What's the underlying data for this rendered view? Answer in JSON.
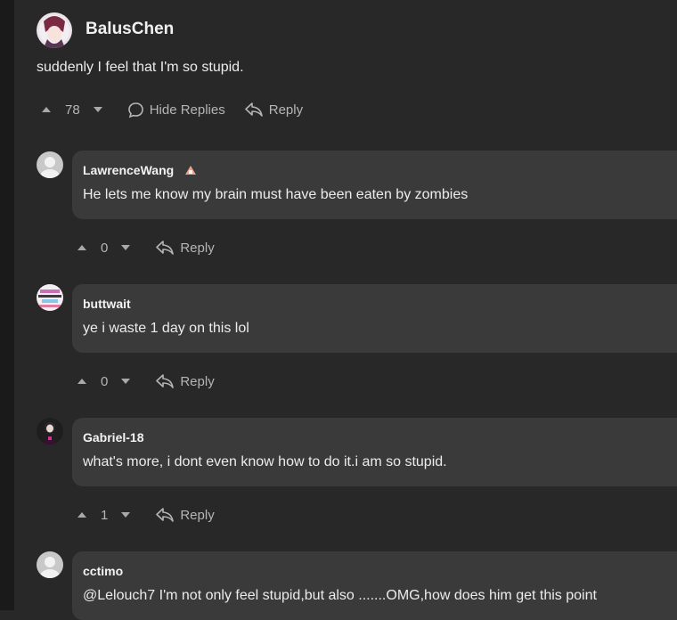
{
  "top_comment": {
    "user": "BalusChen",
    "text": "suddenly I feel that I'm so stupid.",
    "votes": "78",
    "hide_replies_label": "Hide Replies",
    "reply_label": "Reply"
  },
  "replies": [
    {
      "user": "LawrenceWang",
      "text": "He lets me know my brain must have been eaten by zombies",
      "votes": "0",
      "reply_label": "Reply"
    },
    {
      "user": "buttwait",
      "text": "ye i waste 1 day on this lol",
      "votes": "0",
      "reply_label": "Reply"
    },
    {
      "user": "Gabriel-18",
      "text": "what's more, i dont even know how to do it.i am so stupid.",
      "votes": "1",
      "reply_label": "Reply"
    },
    {
      "user": "cctimo",
      "text": "@Lelouch7 I'm not only feel stupid,but also .......OMG,how does him get this point"
    }
  ],
  "colors": {
    "background": "#282828",
    "bubble": "#3a3a3a",
    "muted": "#b5b5b5"
  }
}
